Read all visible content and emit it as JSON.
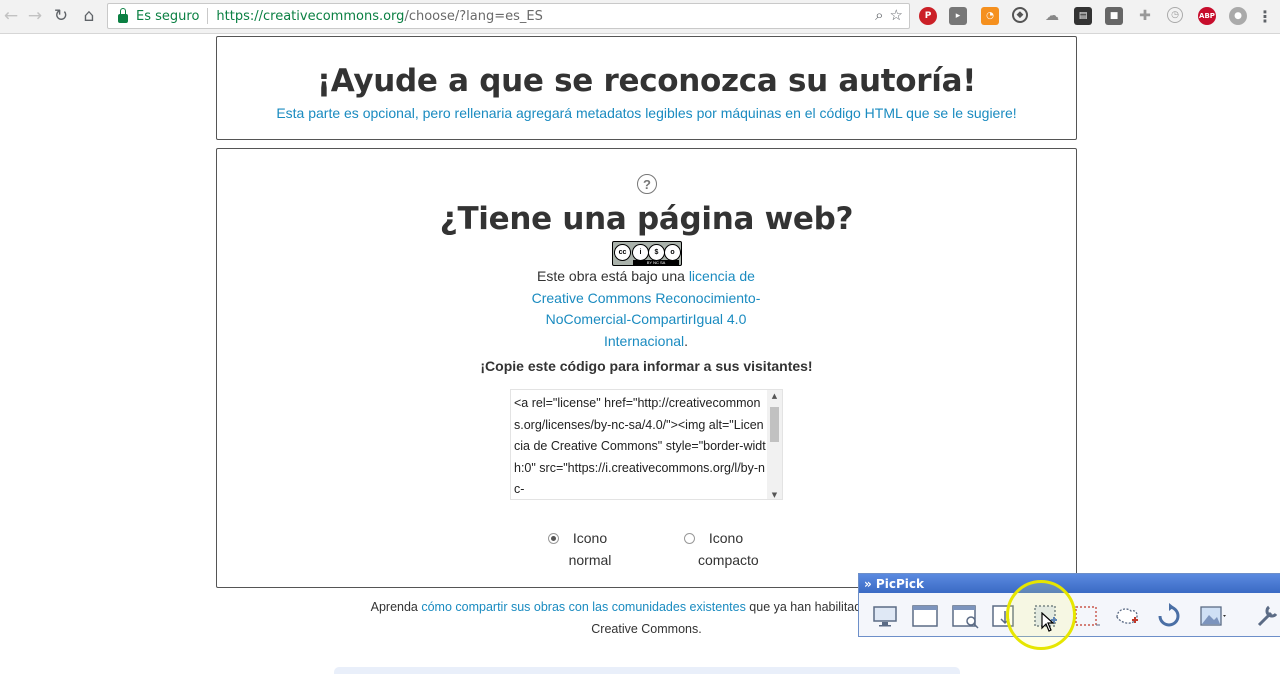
{
  "browser": {
    "secure_label": "Es seguro",
    "url_host": "https://creativecommons.org",
    "url_path": "/choose/?lang=es_ES",
    "extensions": [
      "pinterest-icon",
      "screencast-icon",
      "rss-icon",
      "ext-icon",
      "cloud-icon",
      "film-icon",
      "square-icon",
      "puzzle-icon",
      "clock-icon",
      "abp-icon",
      "ext-gray-icon",
      "menu-icon"
    ],
    "abp_label": "ABP"
  },
  "attribution": {
    "title": "¡Ayude a que se reconozca su autoría!",
    "subtitle": "Esta parte es opcional, pero rellenaria agregará metadatos legibles por máquinas en el código HTML que se le sugiere!"
  },
  "website": {
    "help_label": "?",
    "title": "¿Tiene una página web?",
    "badge": {
      "labels": [
        "cc",
        "i",
        "$",
        "o"
      ],
      "strip": "BY NC SA"
    },
    "license_prefix": "Este obra está bajo una ",
    "license_link": "licencia de Creative Commons Reconocimiento-NoComercial-CompartirIgual 4.0 Internacional",
    "license_suffix": ".",
    "copy_label": "¡Copie este código para informar a sus visitantes!",
    "code": "<a rel=\"license\" href=\"http://creativecommons.org/licenses/by-nc-sa/4.0/\"><img alt=\"Licencia de Creative Commons\" style=\"border-width:0\" src=\"https://i.creativecommons.org/l/by-nc-",
    "radio_normal": "Icono normal",
    "radio_compact": "Icono compacto",
    "selected_radio": "normal"
  },
  "footer": {
    "prefix": "Aprenda ",
    "link": "cómo compartir sus obras con las comunidades existentes",
    "suffix": " que ya han habilitado el uso de",
    "line2": "Creative Commons."
  },
  "picpick": {
    "title": "» PicPick",
    "tools": [
      "monitor-icon",
      "window-icon",
      "scroll-window-icon",
      "scroll-capture-icon",
      "region-icon",
      "fixed-region-icon",
      "freehand-icon",
      "repeat-icon",
      "image-editor-icon",
      "settings-icon"
    ]
  }
}
